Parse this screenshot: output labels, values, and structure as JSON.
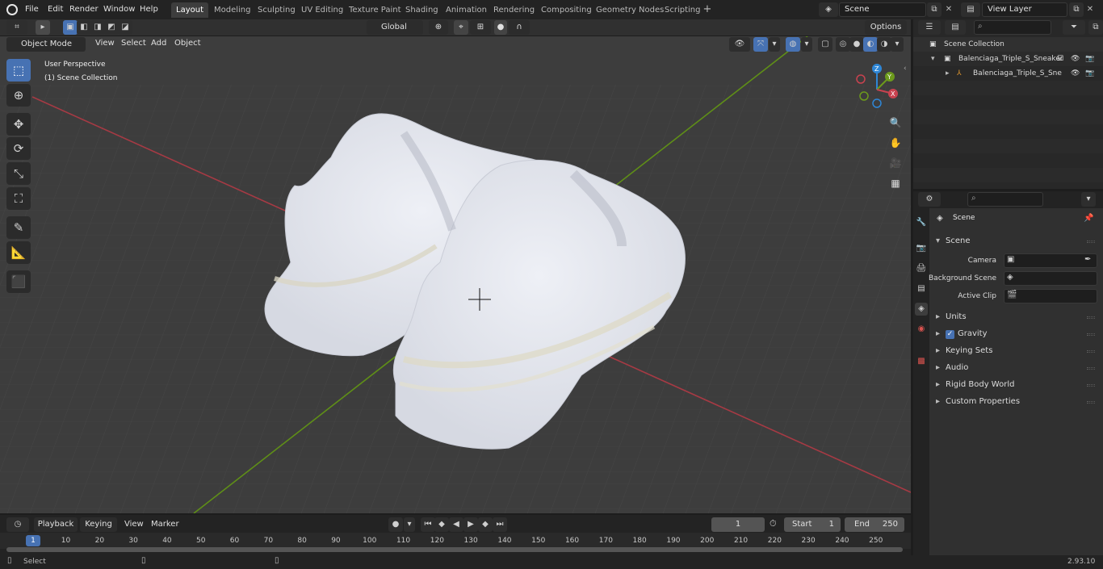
{
  "menu": [
    "File",
    "Edit",
    "Render",
    "Window",
    "Help"
  ],
  "workspaces": [
    "Layout",
    "Modeling",
    "Sculpting",
    "UV Editing",
    "Texture Paint",
    "Shading",
    "Animation",
    "Rendering",
    "Compositing",
    "Geometry Nodes",
    "Scripting"
  ],
  "active_workspace": "Layout",
  "scene_field": "Scene",
  "view_layer_field": "View Layer",
  "viewport": {
    "mode": "Object Mode",
    "menus": [
      "View",
      "Select",
      "Add",
      "Object"
    ],
    "orientation": "Global",
    "options_label": "Options",
    "overlay_line1": "User Perspective",
    "overlay_line2": "(1) Scene Collection",
    "gizmo_axes": {
      "z": "Z",
      "y": "Y",
      "x": "X"
    }
  },
  "outliner": {
    "root": "Scene Collection",
    "items": [
      {
        "label": "Balenciaga_Triple_S_Sneaker",
        "type": "collection"
      },
      {
        "label": "Balenciaga_Triple_S_Sne",
        "type": "object"
      }
    ]
  },
  "properties": {
    "context": "Scene",
    "section": "Scene",
    "fields": [
      {
        "label": "Camera",
        "value": ""
      },
      {
        "label": "Background Scene",
        "value": ""
      },
      {
        "label": "Active Clip",
        "value": ""
      }
    ],
    "panels": [
      "Units",
      "Gravity",
      "Keying Sets",
      "Audio",
      "Rigid Body World",
      "Custom Properties"
    ],
    "gravity_checked": true
  },
  "timeline": {
    "menus": [
      "Playback",
      "Keying",
      "View",
      "Marker"
    ],
    "current_frame": "1",
    "start_label": "Start",
    "start_value": "1",
    "end_label": "End",
    "end_value": "250",
    "ruler": [
      "1",
      "10",
      "20",
      "30",
      "40",
      "50",
      "60",
      "70",
      "80",
      "90",
      "100",
      "110",
      "120",
      "130",
      "140",
      "150",
      "160",
      "170",
      "180",
      "190",
      "200",
      "210",
      "220",
      "230",
      "240",
      "250"
    ]
  },
  "status": {
    "left": "Select",
    "version": "2.93.10"
  },
  "colors": {
    "accent": "#4772b3",
    "x_axis": "#c8424f",
    "y_axis": "#6c9a1c",
    "z_axis": "#2e86d6"
  }
}
